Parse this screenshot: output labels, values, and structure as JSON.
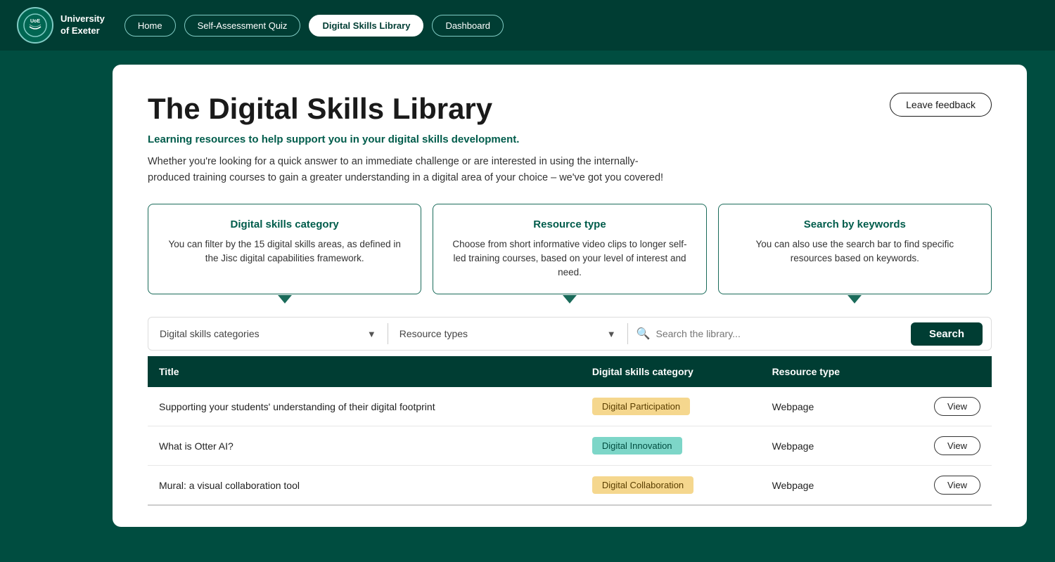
{
  "nav": {
    "logo_text_line1": "University",
    "logo_text_line2": "of Exeter",
    "items": [
      {
        "label": "Home",
        "active": false
      },
      {
        "label": "Self-Assessment Quiz",
        "active": false
      },
      {
        "label": "Digital Skills Library",
        "active": true
      },
      {
        "label": "Dashboard",
        "active": false
      }
    ]
  },
  "main": {
    "title": "The Digital Skills Library",
    "subtitle": "Learning resources to help support you in your digital skills development.",
    "description": "Whether you're looking for a quick answer to an immediate challenge or are interested in using the internally-produced training courses to gain a greater understanding in a digital area of your choice – we've got you covered!",
    "leave_feedback": "Leave feedback",
    "info_boxes": [
      {
        "title": "Digital skills category",
        "text": "You can filter by the 15 digital skills areas, as defined in the Jisc digital capabilities framework."
      },
      {
        "title": "Resource type",
        "text": "Choose from short informative video clips to longer self-led training courses, based on your level of interest and need."
      },
      {
        "title": "Search by keywords",
        "text": "You can also use the search bar to find specific resources based on keywords."
      }
    ],
    "filter": {
      "categories_label": "Digital skills categories",
      "resource_types_label": "Resource types",
      "search_placeholder": "Search the library...",
      "search_button": "Search"
    },
    "table": {
      "headers": [
        "Title",
        "Digital skills category",
        "Resource type",
        ""
      ],
      "rows": [
        {
          "title": "Supporting your students' understanding of their digital footprint",
          "category": "Digital Participation",
          "category_color": "yellow",
          "resource_type": "Webpage",
          "view_label": "View"
        },
        {
          "title": "What is Otter AI?",
          "category": "Digital Innovation",
          "category_color": "teal",
          "resource_type": "Webpage",
          "view_label": "View"
        },
        {
          "title": "Mural: a visual collaboration tool",
          "category": "Digital Collaboration",
          "category_color": "yellow",
          "resource_type": "Webpage",
          "view_label": "View"
        }
      ]
    }
  }
}
